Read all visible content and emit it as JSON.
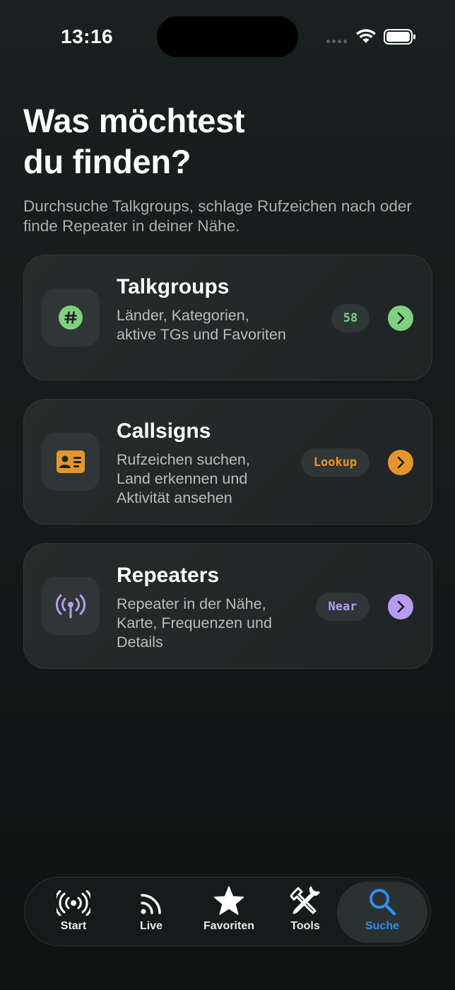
{
  "status_bar": {
    "time": "13:16"
  },
  "header": {
    "title": "Was möchtest\ndu finden?",
    "subtitle": "Durchsuche Talkgroups, schlage Rufzeichen nach oder finde Repeater in deiner Nähe."
  },
  "cards": [
    {
      "title": "Talkgroups",
      "description": "Länder, Kategorien, aktive TGs und Favoriten",
      "badge": "58",
      "accent": "#7fd17f",
      "icon": "hashtag-icon"
    },
    {
      "title": "Callsigns",
      "description": "Rufzeichen suchen, Land erkennen und Aktivität ansehen",
      "badge": "Lookup",
      "accent": "#e6952e",
      "icon": "id-card-icon"
    },
    {
      "title": "Repeaters",
      "description": "Repeater in der Nähe, Karte, Frequenzen und Details",
      "badge": "Near",
      "accent": "#b69cf4",
      "icon": "antenna-icon"
    }
  ],
  "tab_bar": {
    "items": [
      {
        "label": "Start",
        "icon": "broadcast-icon"
      },
      {
        "label": "Live",
        "icon": "rss-icon"
      },
      {
        "label": "Favoriten",
        "icon": "star-icon"
      },
      {
        "label": "Tools",
        "icon": "tools-icon"
      },
      {
        "label": "Suche",
        "icon": "search-icon",
        "active": true
      }
    ],
    "active_color": "#2e8ef2"
  }
}
